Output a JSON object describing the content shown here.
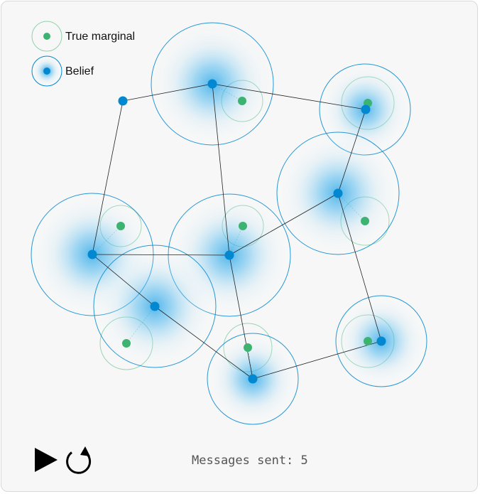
{
  "legend": {
    "true_marginal_label": "True marginal",
    "belief_label": "Belief"
  },
  "colors": {
    "belief": "#0288d1",
    "belief_fill": "#4fc3f7",
    "true_marginal": "#3cb371",
    "edge": "#222222"
  },
  "controls": {
    "play_icon": "play-icon",
    "reset_icon": "reset-icon"
  },
  "status": {
    "messages_label": "Messages sent:",
    "messages_count": "5"
  },
  "graph": {
    "node_ids": [
      "n1",
      "n2",
      "n3",
      "n4",
      "n5",
      "n6",
      "n7",
      "n8",
      "n9",
      "n10"
    ],
    "edges": [
      [
        "n1",
        "n2"
      ],
      [
        "n2",
        "n3"
      ],
      [
        "n1",
        "n4"
      ],
      [
        "n2",
        "n5"
      ],
      [
        "n3",
        "n6"
      ],
      [
        "n4",
        "n5"
      ],
      [
        "n5",
        "n6"
      ],
      [
        "n4",
        "n7"
      ],
      [
        "n5",
        "n8"
      ],
      [
        "n7",
        "n8"
      ],
      [
        "n8",
        "n9"
      ],
      [
        "n6",
        "n9"
      ]
    ]
  }
}
